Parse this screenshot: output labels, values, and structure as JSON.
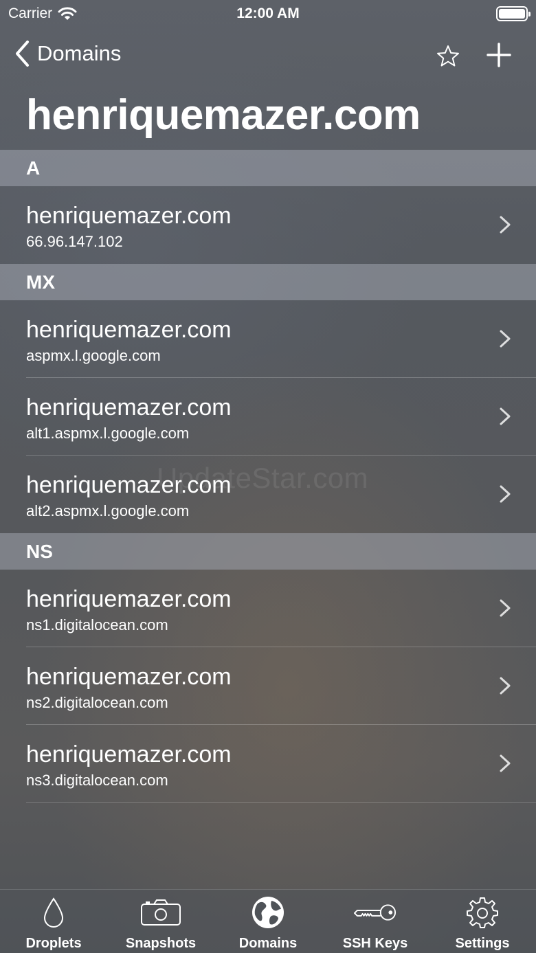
{
  "status_bar": {
    "carrier": "Carrier",
    "time": "12:00 AM"
  },
  "nav": {
    "back_label": "Domains"
  },
  "page_title": "henriquemazer.com",
  "sections": [
    {
      "header": "A",
      "rows": [
        {
          "title": "henriquemazer.com",
          "subtitle": "66.96.147.102"
        }
      ]
    },
    {
      "header": "MX",
      "rows": [
        {
          "title": "henriquemazer.com",
          "subtitle": "aspmx.l.google.com"
        },
        {
          "title": "henriquemazer.com",
          "subtitle": "alt1.aspmx.l.google.com"
        },
        {
          "title": "henriquemazer.com",
          "subtitle": "alt2.aspmx.l.google.com"
        }
      ]
    },
    {
      "header": "NS",
      "rows": [
        {
          "title": "henriquemazer.com",
          "subtitle": "ns1.digitalocean.com"
        },
        {
          "title": "henriquemazer.com",
          "subtitle": "ns2.digitalocean.com"
        },
        {
          "title": "henriquemazer.com",
          "subtitle": "ns3.digitalocean.com"
        }
      ]
    }
  ],
  "watermark": "UpdateStar.com",
  "tabs": [
    {
      "label": "Droplets",
      "icon": "droplet-icon"
    },
    {
      "label": "Snapshots",
      "icon": "camera-icon"
    },
    {
      "label": "Domains",
      "icon": "globe-icon"
    },
    {
      "label": "SSH Keys",
      "icon": "key-icon"
    },
    {
      "label": "Settings",
      "icon": "gear-icon"
    }
  ]
}
